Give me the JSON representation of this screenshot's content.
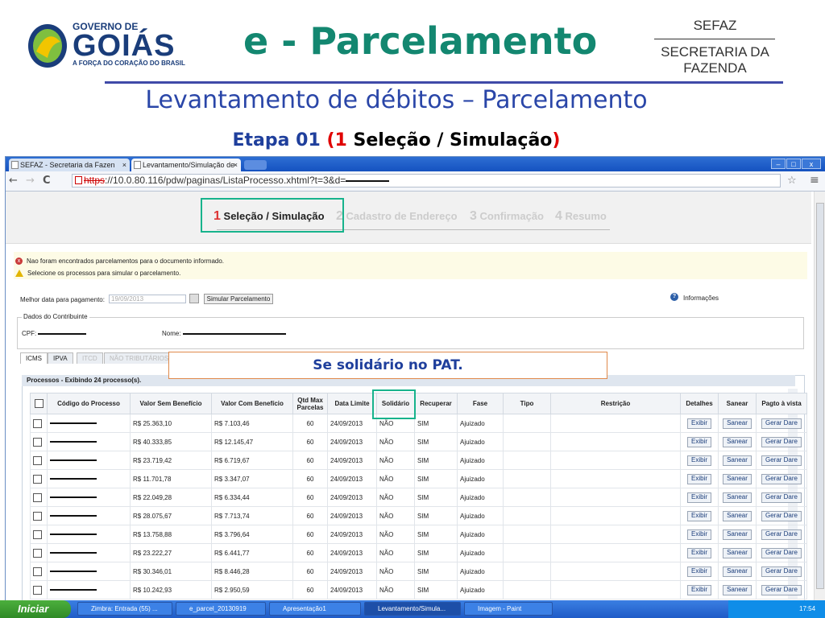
{
  "slide": {
    "logo_line1": "GOVERNO DE",
    "logo_line2": "GOIÁS",
    "logo_tagline": "A FORÇA DO CORAÇÃO DO BRASIL",
    "title": "e - Parcelamento",
    "sefaz_short": "SEFAZ",
    "sefaz_long": "SECRETARIA DA FAZENDA",
    "subtitle": "Levantamento de débitos – Parcelamento",
    "etapa_prefix": "Etapa 01 ",
    "etapa_open": "(",
    "etapa_num": "1",
    "etapa_text": " Seleção / Simulação",
    "etapa_close": ")",
    "callout": "Se solidário no PAT."
  },
  "browser": {
    "tabs": [
      "SEFAZ - Secretaria da Fazen",
      "Levantamento/Simulação de"
    ],
    "url_scheme": "https",
    "url_rest": "://10.0.80.116/pdw/paginas/ListaProcesso.xhtml?t=3&d="
  },
  "wizard": {
    "steps": [
      {
        "num": "1",
        "label": "Seleção / Simulação"
      },
      {
        "num": "2",
        "label": "Cadastro de Endereço"
      },
      {
        "num": "3",
        "label": "Confirmação"
      },
      {
        "num": "4",
        "label": "Resumo"
      }
    ]
  },
  "messages": {
    "error": "Nao foram encontrados parcelamentos para o documento informado.",
    "warning": "Selecione os processos para simular o parcelamento."
  },
  "form": {
    "date_label": "Melhor data para pagamento:",
    "date_value": "19/09/2013",
    "simulate_button": "Simular Parcelamento",
    "info_label": "Informações",
    "contribuinte_legend": "Dados do Contribuinte",
    "cpf_label": "CPF:",
    "nome_label": "Nome:"
  },
  "tax_tabs": [
    "ICMS",
    "IPVA",
    "ITCD",
    "NÃO TRIBUTÁRIOS"
  ],
  "table": {
    "caption": "Processos - Exibindo 24 processo(s).",
    "headers": [
      "Código do Processo",
      "Valor Sem Benefício",
      "Valor Com Benefício",
      "Qtd Max Parcelas",
      "Data Limite",
      "Solidário",
      "Recuperar",
      "Fase",
      "Tipo",
      "Restrição",
      "Detalhes",
      "Sanear",
      "Pagto à vista"
    ],
    "rows": [
      [
        "R$ 25.363,10",
        "R$ 7.103,46",
        "60",
        "24/09/2013",
        "NÃO",
        "SIM",
        "Ajuizado"
      ],
      [
        "R$ 40.333,85",
        "R$ 12.145,47",
        "60",
        "24/09/2013",
        "NÃO",
        "SIM",
        "Ajuizado"
      ],
      [
        "R$ 23.719,42",
        "R$ 6.719,67",
        "60",
        "24/09/2013",
        "NÃO",
        "SIM",
        "Ajuizado"
      ],
      [
        "R$ 11.701,78",
        "R$ 3.347,07",
        "60",
        "24/09/2013",
        "NÃO",
        "SIM",
        "Ajuizado"
      ],
      [
        "R$ 22.049,28",
        "R$ 6.334,44",
        "60",
        "24/09/2013",
        "NÃO",
        "SIM",
        "Ajuizado"
      ],
      [
        "R$ 28.075,67",
        "R$ 7.713,74",
        "60",
        "24/09/2013",
        "NÃO",
        "SIM",
        "Ajuizado"
      ],
      [
        "R$ 13.758,88",
        "R$ 3.796,64",
        "60",
        "24/09/2013",
        "NÃO",
        "SIM",
        "Ajuizado"
      ],
      [
        "R$ 23.222,27",
        "R$ 6.441,77",
        "60",
        "24/09/2013",
        "NÃO",
        "SIM",
        "Ajuizado"
      ],
      [
        "R$ 30.346,01",
        "R$ 8.446,28",
        "60",
        "24/09/2013",
        "NÃO",
        "SIM",
        "Ajuizado"
      ],
      [
        "R$ 10.242,93",
        "R$ 2.950,59",
        "60",
        "24/09/2013",
        "NÃO",
        "SIM",
        "Ajuizado"
      ]
    ],
    "btn_exibir": "Exibir",
    "btn_sanear": "Sanear",
    "btn_gerar": "Gerar Dare"
  },
  "taskbar": {
    "start": "Iniciar",
    "items": [
      "Zimbra: Entrada (55) ...",
      "e_parcel_20130919",
      "Apresentação1",
      "Levantamento/Simula...",
      "Imagem - Paint"
    ],
    "clock": "17:54"
  },
  "colors": {
    "title_green": "#138770",
    "subtitle_blue": "#2a46a8",
    "highlight_green": "#17b38c"
  }
}
